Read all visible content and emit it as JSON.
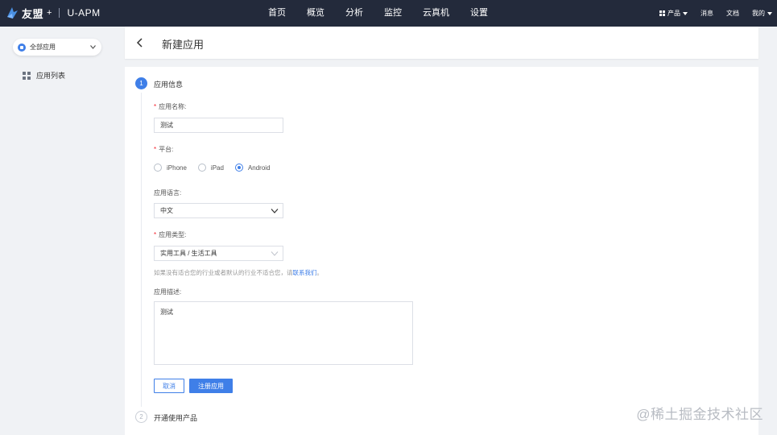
{
  "topbar": {
    "brand": "友盟",
    "brand_plus": "+",
    "product": "U-APM",
    "nav": [
      "首页",
      "概览",
      "分析",
      "监控",
      "云真机",
      "设置"
    ],
    "right": {
      "products": "产品",
      "messages": "消息",
      "docs": "文档",
      "mine": "我的"
    }
  },
  "sidebar": {
    "app_select": "全部应用",
    "items": [
      {
        "label": "应用列表",
        "icon": "grid-icon"
      }
    ]
  },
  "header": {
    "title": "新建应用"
  },
  "steps": [
    {
      "number": "1",
      "title": "应用信息"
    },
    {
      "number": "2",
      "title": "开通使用产品"
    }
  ],
  "form": {
    "name": {
      "label": "应用名称:",
      "required": true,
      "value": "测试"
    },
    "platform": {
      "label": "平台:",
      "required": true,
      "options": [
        "iPhone",
        "iPad",
        "Android"
      ],
      "selected": "Android"
    },
    "language": {
      "label": "应用语言:",
      "value": "中文"
    },
    "category": {
      "label": "应用类型:",
      "required": true,
      "value": "实用工具 / 生活工具"
    },
    "hint": {
      "text": "如果没有适合您的行业或者默认的行业不适合您，请",
      "link": "联系我们",
      "end": "。"
    },
    "description": {
      "label": "应用描述:",
      "value": "测试"
    },
    "cancel_label": "取消",
    "submit_label": "注册应用"
  },
  "watermark": "@稀土掘金技术社区",
  "colors": {
    "topbar_bg": "#232a3b",
    "accent": "#3f7fe8",
    "page_bg": "#f0f2f5"
  }
}
